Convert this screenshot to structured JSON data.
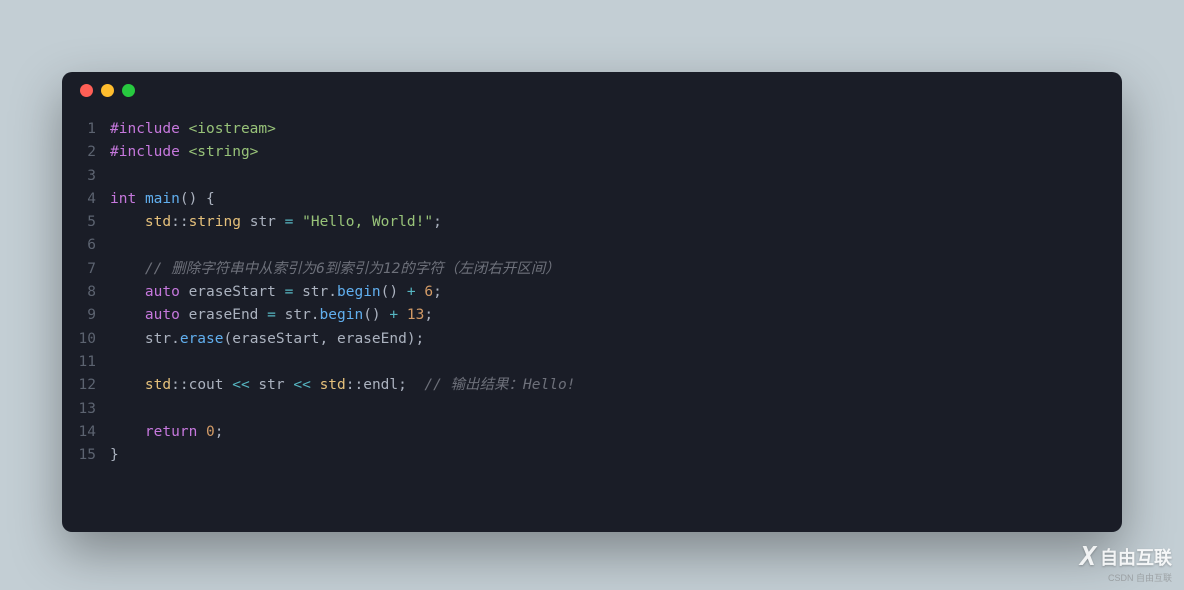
{
  "window": {
    "dots": [
      "red",
      "yellow",
      "green"
    ]
  },
  "code": {
    "lines": [
      {
        "n": "1",
        "tokens": [
          {
            "c": "tok-pre",
            "t": "#include"
          },
          {
            "c": "tok-punc",
            "t": " "
          },
          {
            "c": "tok-inc",
            "t": "<iostream>"
          }
        ]
      },
      {
        "n": "2",
        "tokens": [
          {
            "c": "tok-pre",
            "t": "#include"
          },
          {
            "c": "tok-punc",
            "t": " "
          },
          {
            "c": "tok-inc",
            "t": "<string>"
          }
        ]
      },
      {
        "n": "3",
        "tokens": []
      },
      {
        "n": "4",
        "tokens": [
          {
            "c": "tok-type",
            "t": "int"
          },
          {
            "c": "tok-punc",
            "t": " "
          },
          {
            "c": "tok-func",
            "t": "main"
          },
          {
            "c": "tok-punc",
            "t": "() {"
          }
        ]
      },
      {
        "n": "5",
        "tokens": [
          {
            "c": "tok-punc",
            "t": "    "
          },
          {
            "c": "tok-ns",
            "t": "std"
          },
          {
            "c": "tok-punc",
            "t": "::"
          },
          {
            "c": "tok-ns",
            "t": "string"
          },
          {
            "c": "tok-punc",
            "t": " str "
          },
          {
            "c": "tok-op",
            "t": "="
          },
          {
            "c": "tok-punc",
            "t": " "
          },
          {
            "c": "tok-str",
            "t": "\"Hello, World!\""
          },
          {
            "c": "tok-punc",
            "t": ";"
          }
        ]
      },
      {
        "n": "6",
        "tokens": []
      },
      {
        "n": "7",
        "tokens": [
          {
            "c": "tok-punc",
            "t": "    "
          },
          {
            "c": "tok-com",
            "t": "// 删除字符串中从索引为6到索引为12的字符（左闭右开区间）"
          }
        ]
      },
      {
        "n": "8",
        "tokens": [
          {
            "c": "tok-punc",
            "t": "    "
          },
          {
            "c": "tok-kw",
            "t": "auto"
          },
          {
            "c": "tok-punc",
            "t": " eraseStart "
          },
          {
            "c": "tok-op",
            "t": "="
          },
          {
            "c": "tok-punc",
            "t": " str."
          },
          {
            "c": "tok-func",
            "t": "begin"
          },
          {
            "c": "tok-punc",
            "t": "() "
          },
          {
            "c": "tok-op",
            "t": "+"
          },
          {
            "c": "tok-punc",
            "t": " "
          },
          {
            "c": "tok-num",
            "t": "6"
          },
          {
            "c": "tok-punc",
            "t": ";"
          }
        ]
      },
      {
        "n": "9",
        "tokens": [
          {
            "c": "tok-punc",
            "t": "    "
          },
          {
            "c": "tok-kw",
            "t": "auto"
          },
          {
            "c": "tok-punc",
            "t": " eraseEnd "
          },
          {
            "c": "tok-op",
            "t": "="
          },
          {
            "c": "tok-punc",
            "t": " str."
          },
          {
            "c": "tok-func",
            "t": "begin"
          },
          {
            "c": "tok-punc",
            "t": "() "
          },
          {
            "c": "tok-op",
            "t": "+"
          },
          {
            "c": "tok-punc",
            "t": " "
          },
          {
            "c": "tok-num",
            "t": "13"
          },
          {
            "c": "tok-punc",
            "t": ";"
          }
        ]
      },
      {
        "n": "10",
        "tokens": [
          {
            "c": "tok-punc",
            "t": "    str."
          },
          {
            "c": "tok-func",
            "t": "erase"
          },
          {
            "c": "tok-punc",
            "t": "(eraseStart, eraseEnd);"
          }
        ]
      },
      {
        "n": "11",
        "tokens": []
      },
      {
        "n": "12",
        "tokens": [
          {
            "c": "tok-punc",
            "t": "    "
          },
          {
            "c": "tok-ns",
            "t": "std"
          },
          {
            "c": "tok-punc",
            "t": "::cout "
          },
          {
            "c": "tok-op",
            "t": "<<"
          },
          {
            "c": "tok-punc",
            "t": " str "
          },
          {
            "c": "tok-op",
            "t": "<<"
          },
          {
            "c": "tok-punc",
            "t": " "
          },
          {
            "c": "tok-ns",
            "t": "std"
          },
          {
            "c": "tok-punc",
            "t": "::endl;  "
          },
          {
            "c": "tok-com",
            "t": "// 输出结果：Hello!"
          }
        ]
      },
      {
        "n": "13",
        "tokens": []
      },
      {
        "n": "14",
        "tokens": [
          {
            "c": "tok-punc",
            "t": "    "
          },
          {
            "c": "tok-kw",
            "t": "return"
          },
          {
            "c": "tok-punc",
            "t": " "
          },
          {
            "c": "tok-num",
            "t": "0"
          },
          {
            "c": "tok-punc",
            "t": ";"
          }
        ]
      },
      {
        "n": "15",
        "tokens": [
          {
            "c": "tok-punc",
            "t": "}"
          }
        ]
      }
    ]
  },
  "watermark": {
    "x": "X",
    "text": "自由互联",
    "sub": "CSDN 自由互联"
  }
}
